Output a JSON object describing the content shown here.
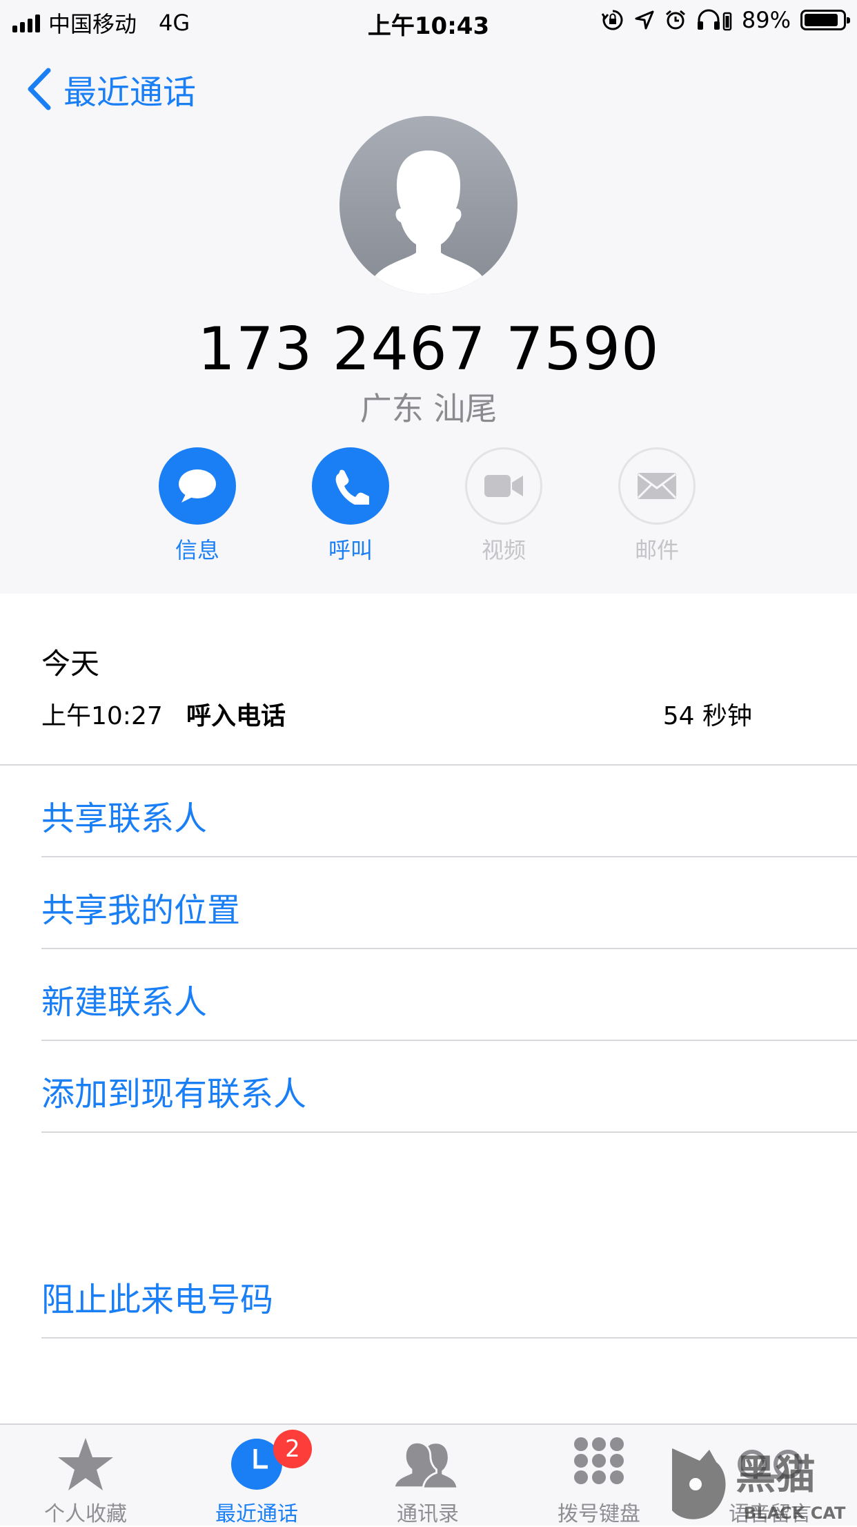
{
  "status_bar": {
    "carrier": "中国移动",
    "network": "4G",
    "time": "上午10:43",
    "battery_percent": "89%",
    "battery_level": 0.89
  },
  "nav": {
    "back_label": "最近通话"
  },
  "contact": {
    "number": "173 2467 7590",
    "location": "广东 汕尾"
  },
  "actions": [
    {
      "label": "信息",
      "icon": "message-icon",
      "enabled": true
    },
    {
      "label": "呼叫",
      "icon": "phone-icon",
      "enabled": true
    },
    {
      "label": "视频",
      "icon": "video-icon",
      "enabled": false
    },
    {
      "label": "邮件",
      "icon": "mail-icon",
      "enabled": false
    }
  ],
  "call_log": {
    "day": "今天",
    "entries": [
      {
        "time": "上午10:27",
        "type": "呼入电话",
        "duration": "54 秒钟"
      }
    ]
  },
  "options": [
    {
      "label": "共享联系人"
    },
    {
      "label": "共享我的位置"
    },
    {
      "label": "新建联系人"
    },
    {
      "label": "添加到现有联系人"
    }
  ],
  "block_option": {
    "label": "阻止此来电号码"
  },
  "tabs": [
    {
      "label": "个人收藏",
      "icon": "star-icon",
      "active": false
    },
    {
      "label": "最近通话",
      "icon": "clock-icon",
      "active": true,
      "badge": "2"
    },
    {
      "label": "通讯录",
      "icon": "contacts-icon",
      "active": false
    },
    {
      "label": "拨号键盘",
      "icon": "keypad-icon",
      "active": false
    },
    {
      "label": "语音留言",
      "icon": "voicemail-icon",
      "active": false
    }
  ],
  "watermark": {
    "text": "黑猫",
    "subtext": "BLACK CAT"
  },
  "colors": {
    "accent": "#1a7ff5",
    "badge": "#fc3d39",
    "disabled": "#c4c4c8"
  }
}
